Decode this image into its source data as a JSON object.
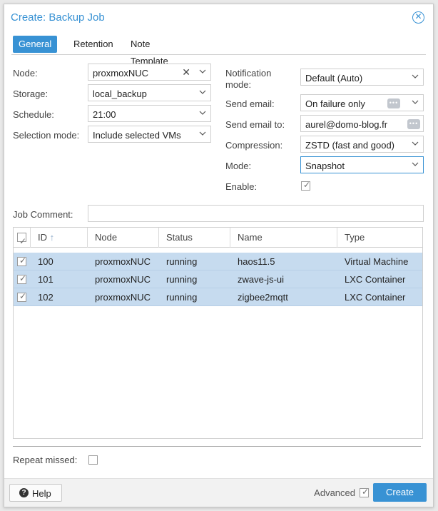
{
  "dialog": {
    "title": "Create: Backup Job"
  },
  "tabs": [
    {
      "label": "General"
    },
    {
      "label": "Retention"
    },
    {
      "label": "Note Template"
    }
  ],
  "left": {
    "node": {
      "label": "Node:",
      "value": "proxmoxNUC"
    },
    "storage": {
      "label": "Storage:",
      "value": "local_backup"
    },
    "schedule": {
      "label": "Schedule:",
      "value": "21:00"
    },
    "selection_mode": {
      "label": "Selection mode:",
      "value": "Include selected VMs"
    }
  },
  "right": {
    "notification_mode": {
      "label_line1": "Notification",
      "label_line2": "mode:",
      "value": "Default (Auto)"
    },
    "send_email": {
      "label": "Send email:",
      "value": "On failure only"
    },
    "send_email_to": {
      "label": "Send email to:",
      "value": "aurel@domo-blog.fr"
    },
    "compression": {
      "label": "Compression:",
      "value": "ZSTD (fast and good)"
    },
    "mode": {
      "label": "Mode:",
      "value": "Snapshot"
    },
    "enable": {
      "label": "Enable:",
      "checked": true
    }
  },
  "job_comment": {
    "label": "Job Comment:",
    "value": ""
  },
  "grid": {
    "columns": [
      "ID",
      "Node",
      "Status",
      "Name",
      "Type"
    ],
    "sort_indicator": "↑",
    "rows": [
      {
        "id": "100",
        "node": "proxmoxNUC",
        "status": "running",
        "name": "haos11.5",
        "type": "Virtual Machine",
        "selected": true
      },
      {
        "id": "101",
        "node": "proxmoxNUC",
        "status": "running",
        "name": "zwave-js-ui",
        "type": "LXC Container",
        "selected": true
      },
      {
        "id": "102",
        "node": "proxmoxNUC",
        "status": "running",
        "name": "zigbee2mqtt",
        "type": "LXC Container",
        "selected": true
      }
    ]
  },
  "repeat_missed": {
    "label": "Repeat missed:",
    "checked": false
  },
  "footer": {
    "help_label": "Help",
    "advanced_label": "Advanced",
    "advanced_checked": true,
    "create_label": "Create"
  },
  "icons": {
    "close": "close-icon",
    "help": "question-circle-icon",
    "dropdown": "chevron-down-icon",
    "clear": "clear-x-icon",
    "more": "ellipsis-icon",
    "sort": "sort-ascending-icon"
  },
  "colors": {
    "accent": "#3892d4",
    "row_selected": "#c6dbef"
  }
}
